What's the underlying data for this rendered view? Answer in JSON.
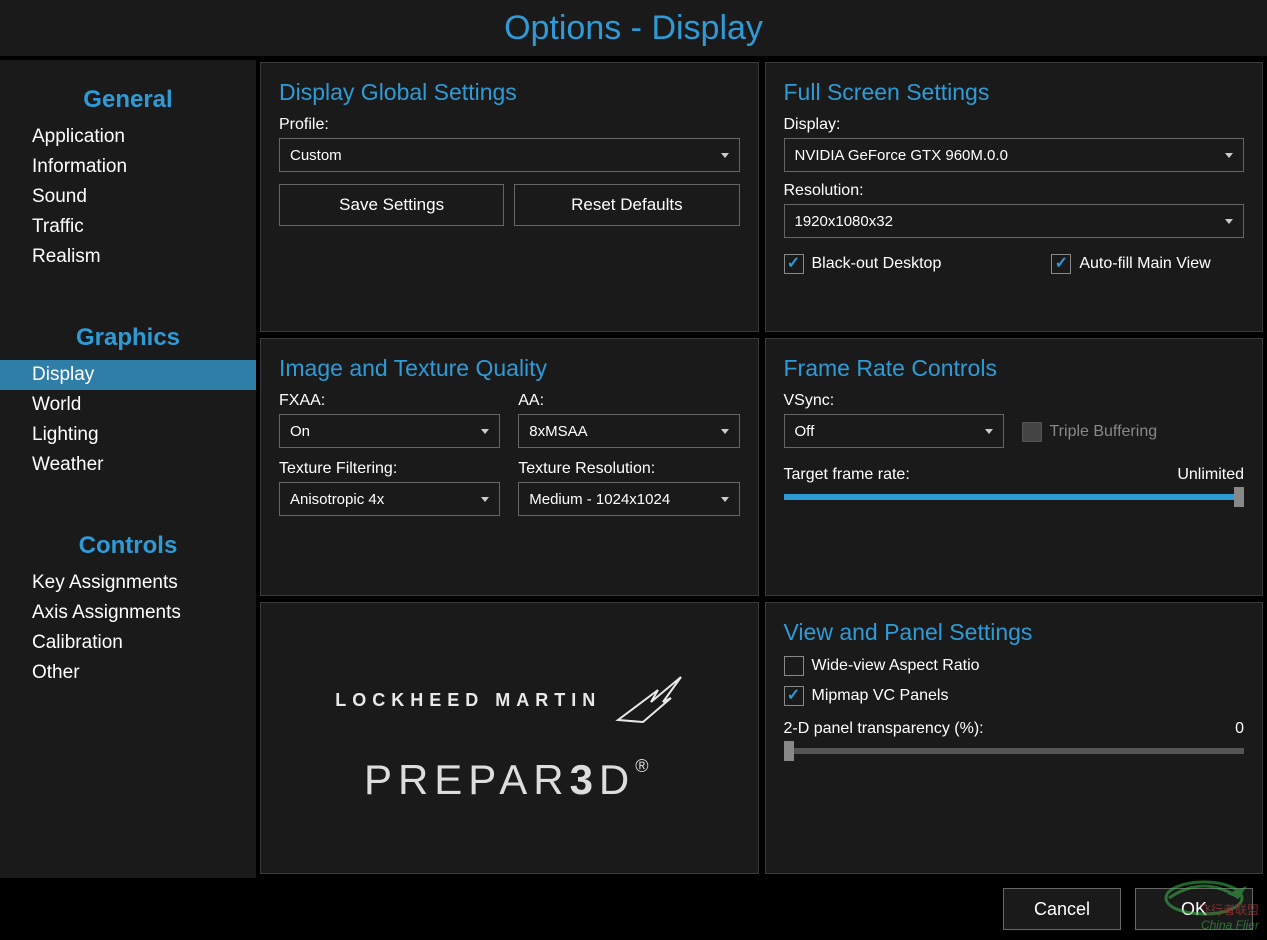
{
  "header": {
    "title": "Options - Display"
  },
  "sidebar": {
    "groups": [
      {
        "title": "General",
        "items": [
          "Application",
          "Information",
          "Sound",
          "Traffic",
          "Realism"
        ]
      },
      {
        "title": "Graphics",
        "items": [
          "Display",
          "World",
          "Lighting",
          "Weather"
        ],
        "selected": "Display"
      },
      {
        "title": "Controls",
        "items": [
          "Key Assignments",
          "Axis Assignments",
          "Calibration",
          "Other"
        ]
      }
    ]
  },
  "globalSettings": {
    "title": "Display Global Settings",
    "profileLabel": "Profile:",
    "profileValue": "Custom",
    "saveBtn": "Save Settings",
    "resetBtn": "Reset Defaults"
  },
  "fullScreen": {
    "title": "Full Screen Settings",
    "displayLabel": "Display:",
    "displayValue": "NVIDIA GeForce GTX 960M.0.0",
    "resolutionLabel": "Resolution:",
    "resolutionValue": "1920x1080x32",
    "blackoutLabel": "Black-out Desktop",
    "blackoutChecked": true,
    "autofillLabel": "Auto-fill Main View",
    "autofillChecked": true
  },
  "imageQuality": {
    "title": "Image and Texture Quality",
    "fxaaLabel": "FXAA:",
    "fxaaValue": "On",
    "aaLabel": "AA:",
    "aaValue": "8xMSAA",
    "texFilterLabel": "Texture Filtering:",
    "texFilterValue": "Anisotropic 4x",
    "texResLabel": "Texture Resolution:",
    "texResValue": "Medium - 1024x1024"
  },
  "frameRate": {
    "title": "Frame Rate Controls",
    "vsyncLabel": "VSync:",
    "vsyncValue": "Off",
    "tripleBufferLabel": "Triple Buffering",
    "tripleBufferEnabled": false,
    "targetLabel": "Target frame rate:",
    "targetValue": "Unlimited"
  },
  "logo": {
    "company": "LOCKHEED MARTIN",
    "product_prefix": "PREPAR",
    "product_digit": "3",
    "product_suffix": "D",
    "registered": "®"
  },
  "viewPanel": {
    "title": "View and Panel Settings",
    "wideLabel": "Wide-view Aspect Ratio",
    "wideChecked": false,
    "mipmapLabel": "Mipmap VC Panels",
    "mipmapChecked": true,
    "transparencyLabel": "2-D panel transparency (%):",
    "transparencyValue": "0"
  },
  "footer": {
    "cancel": "Cancel",
    "ok": "OK"
  },
  "watermark": {
    "line1": "飞行者联盟",
    "line2": "China Flier"
  }
}
